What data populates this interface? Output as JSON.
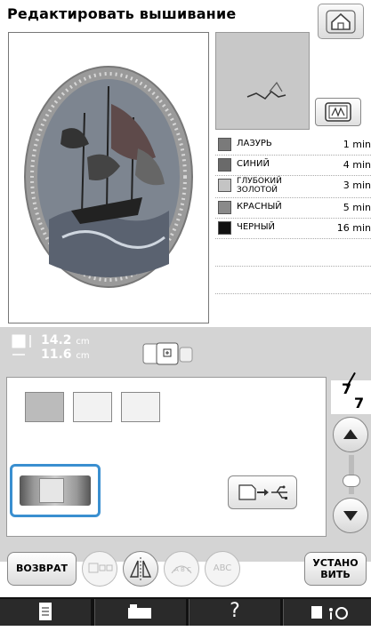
{
  "title": "Редактировать вышивание",
  "threads": [
    {
      "name": "ЛАЗУРЬ",
      "time": "1 min",
      "color": "#7a7a7a"
    },
    {
      "name": "СИНИЙ",
      "time": "4 min",
      "color": "#6a6a6a"
    },
    {
      "name": "ГЛУБОКИЙ ЗОЛОТОЙ",
      "time": "3 min",
      "color": "#c4c4c4"
    },
    {
      "name": "КРАСНЫЙ",
      "time": "5 min",
      "color": "#8a8a8a"
    },
    {
      "name": "ЧЕРНЫЙ",
      "time": "16 min",
      "color": "#111111"
    }
  ],
  "size": {
    "height_value": "14.2",
    "width_value": "11.6",
    "unit": "cm"
  },
  "page": {
    "current": "7",
    "total": "7"
  },
  "buttons": {
    "back": "ВОЗВРАТ",
    "set": "УСТАНО ВИТЬ",
    "abc_outline": "ABC",
    "abc_check": "ABC",
    "help": "?"
  },
  "icons": {
    "home": "home-icon",
    "frame": "hoop-icon",
    "usb": "usb-icon",
    "help": "help-icon"
  }
}
